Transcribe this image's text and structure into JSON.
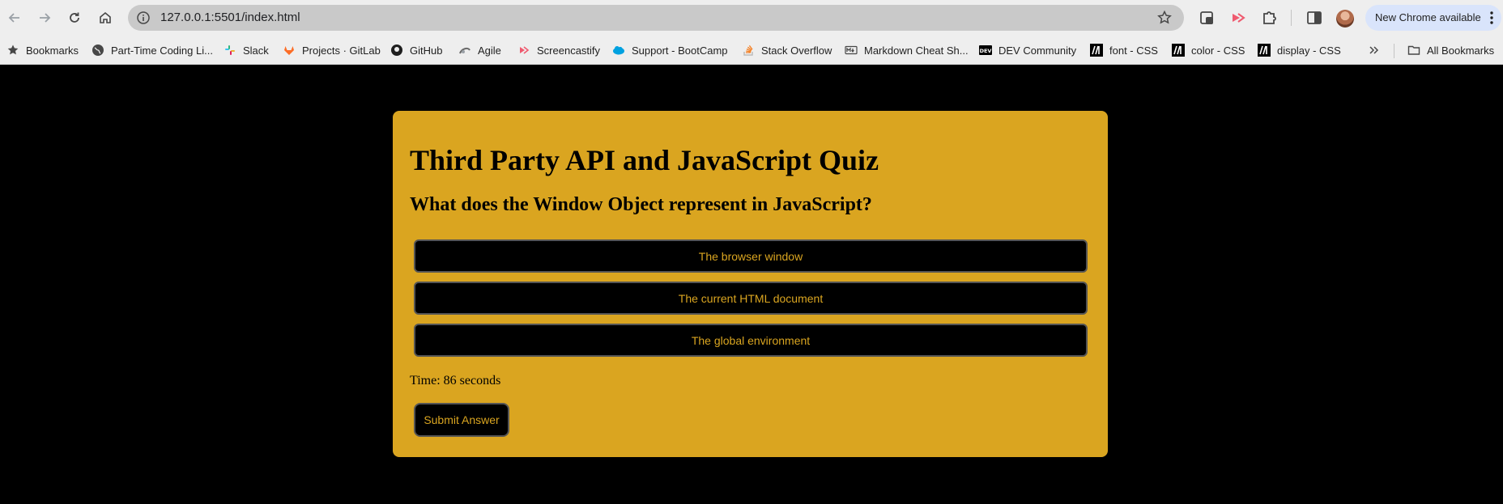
{
  "browser": {
    "url": "127.0.0.1:5501/index.html",
    "update_label": "New Chrome available"
  },
  "bookmarks": [
    {
      "label": "Bookmarks",
      "icon": "star-icon"
    },
    {
      "label": "Part-Time Coding Li...",
      "icon": "globe-icon"
    },
    {
      "label": "Slack",
      "icon": "slack-icon"
    },
    {
      "label": "Projects · GitLab",
      "icon": "gitlab-icon"
    },
    {
      "label": "GitHub",
      "icon": "github-icon"
    },
    {
      "label": "Agile",
      "icon": "agile-icon"
    },
    {
      "label": "Screencastify",
      "icon": "screencastify-icon"
    },
    {
      "label": "Support - BootCamp",
      "icon": "salesforce-icon"
    },
    {
      "label": "Stack Overflow",
      "icon": "stackoverflow-icon"
    },
    {
      "label": "Markdown Cheat Sh...",
      "icon": "markdown-icon"
    },
    {
      "label": "DEV Community",
      "icon": "dev-icon"
    },
    {
      "label": "font - CSS",
      "icon": "mdn-icon"
    },
    {
      "label": "color - CSS",
      "icon": "mdn-icon"
    },
    {
      "label": "display - CSS",
      "icon": "mdn-icon"
    },
    {
      "label": "All Bookmarks",
      "icon": "folder-icon"
    }
  ],
  "quiz": {
    "title": "Third Party API and JavaScript Quiz",
    "question": "What does the Window Object represent in JavaScript?",
    "answers": [
      "The browser window",
      "The current HTML document",
      "The global environment"
    ],
    "timer_text": "Time: 86 seconds",
    "submit_label": "Submit Answer"
  },
  "colors": {
    "card_background": "#daa520",
    "answer_text": "#daa520",
    "page_background": "#000000"
  }
}
